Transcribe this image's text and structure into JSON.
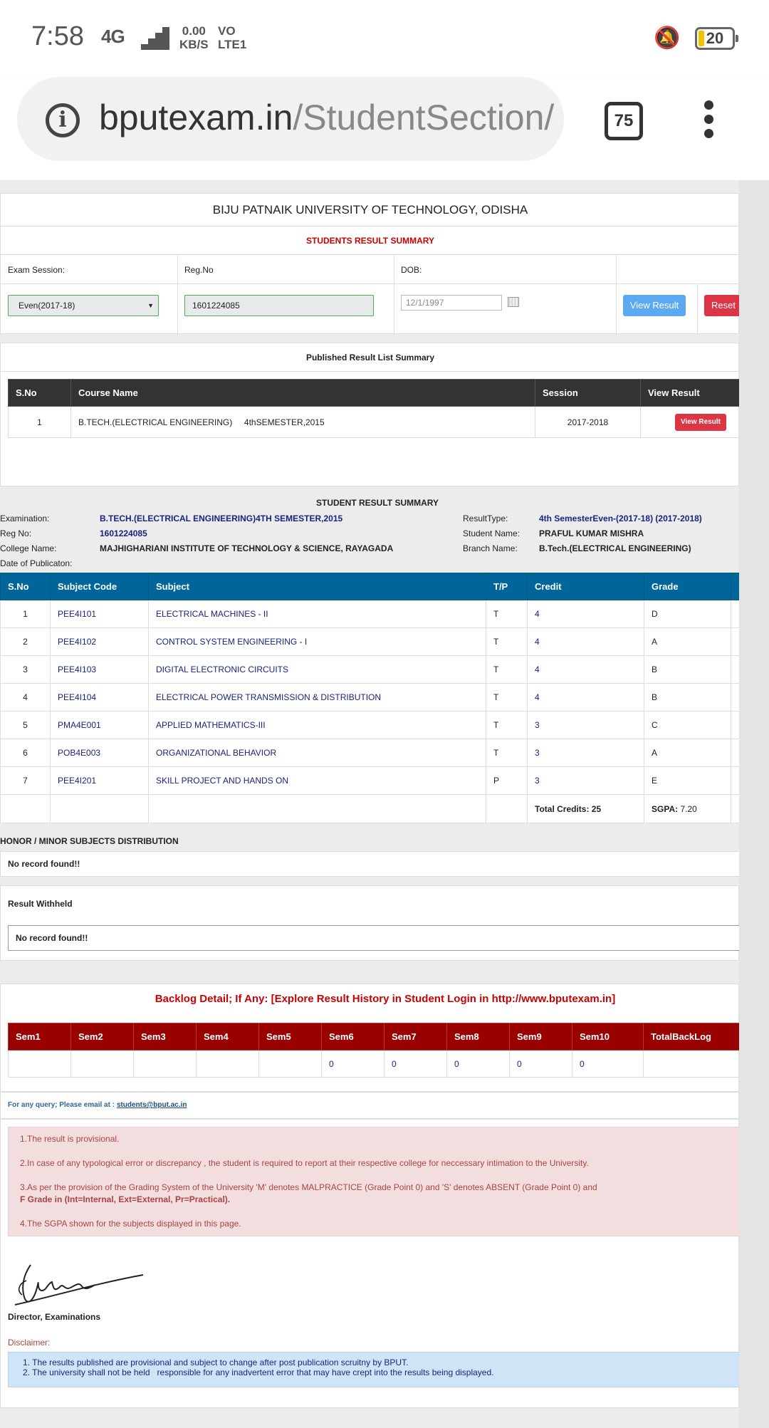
{
  "status": {
    "time": "7:58",
    "network": "4G",
    "speed_value": "0.00",
    "speed_unit": "KB/S",
    "volte": "VO",
    "lte": "LTE1",
    "battery": "20"
  },
  "browser": {
    "url_host": "bputexam.in",
    "url_path": "/StudentSection/",
    "tab_count": "75"
  },
  "header": {
    "university": "BIJU PATNAIK UNIVERSITY OF TECHNOLOGY, ODISHA",
    "summary_title": "STUDENTS RESULT SUMMARY"
  },
  "form": {
    "session_label": "Exam Session:",
    "reg_label": "Reg.No",
    "dob_label": "DOB:",
    "session_value": "Even(2017-18)",
    "reg_value": "1601224085",
    "dob_value": "12/1/1997",
    "view_btn": "View Result",
    "reset_btn": "Reset"
  },
  "published": {
    "title": "Published Result  List Summary",
    "headers": [
      "S.No",
      "Course Name",
      "Session",
      "View Result"
    ],
    "row": {
      "sno": "1",
      "course": "B.TECH.(ELECTRICAL ENGINEERING)     4thSEMESTER,2015",
      "session": "2017-2018",
      "btn": "View Result"
    }
  },
  "student": {
    "title": "STUDENT RESULT SUMMARY",
    "exam_label": "Examination:",
    "exam_value": "B.TECH.(ELECTRICAL ENGINEERING)4TH SEMESTER,2015",
    "reg_label": "Reg No:",
    "reg_value": "1601224085",
    "college_label": "College Name:",
    "college_value": "MAJHIGHARIANI INSTITUTE OF TECHNOLOGY & SCIENCE, RAYAGADA",
    "pub_label": "Date of Publicaton:",
    "rtype_label": "ResultType:",
    "rtype_value": "4th SemesterEven-(2017-18) (2017-2018)",
    "name_label": "Student Name:",
    "name_value": "PRAFUL KUMAR MISHRA",
    "branch_label": "Branch Name:",
    "branch_value": "B.Tech.(ELECTRICAL ENGINEERING)"
  },
  "grades": {
    "headers": [
      "S.No",
      "Subject Code",
      "Subject",
      "T/P",
      "Credit",
      "Grade"
    ],
    "rows": [
      {
        "sno": "1",
        "code": "PEE4I101",
        "subject": "ELECTRICAL MACHINES - II",
        "tp": "T",
        "credit": "4",
        "grade": "D"
      },
      {
        "sno": "2",
        "code": "PEE4I102",
        "subject": "CONTROL SYSTEM ENGINEERING - I",
        "tp": "T",
        "credit": "4",
        "grade": "A"
      },
      {
        "sno": "3",
        "code": "PEE4I103",
        "subject": "DIGITAL ELECTRONIC CIRCUITS",
        "tp": "T",
        "credit": "4",
        "grade": "B"
      },
      {
        "sno": "4",
        "code": "PEE4I104",
        "subject": "ELECTRICAL POWER TRANSMISSION & DISTRIBUTION",
        "tp": "T",
        "credit": "4",
        "grade": "B"
      },
      {
        "sno": "5",
        "code": "PMA4E001",
        "subject": "APPLIED MATHEMATICS-III",
        "tp": "T",
        "credit": "3",
        "grade": "C"
      },
      {
        "sno": "6",
        "code": "POB4E003",
        "subject": "ORGANIZATIONAL BEHAVIOR",
        "tp": "T",
        "credit": "3",
        "grade": "A"
      },
      {
        "sno": "7",
        "code": "PEE4I201",
        "subject": "SKILL PROJECT AND HANDS ON",
        "tp": "P",
        "credit": "3",
        "grade": "E"
      }
    ],
    "total_credits": "Total Credits: 25",
    "sgpa_label": "SGPA:",
    "sgpa_value": "7.20"
  },
  "honor": {
    "title": "HONOR / MINOR SUBJECTS DISTRIBUTION",
    "empty": "No record found!!"
  },
  "withheld": {
    "title": "Result Withheld",
    "empty": "No record found!!"
  },
  "backlog": {
    "title": "Backlog Detail; If Any: [Explore Result History in Student Login in http://www.bputexam.in]",
    "headers": [
      "Sem1",
      "Sem2",
      "Sem3",
      "Sem4",
      "Sem5",
      "Sem6",
      "Sem7",
      "Sem8",
      "Sem9",
      "Sem10",
      "TotalBackLog"
    ],
    "values": [
      "",
      "",
      "",
      "",
      "",
      "0",
      "0",
      "0",
      "0",
      "0",
      ""
    ]
  },
  "query": {
    "text": "For any query;  Please email at :",
    "email": "students@bput.ac.in"
  },
  "notes": [
    "1.The result is provisional.",
    "2.In case of any typological error or discrepancy , the student is required to report at their respective college for neccessary intimation to the University.",
    "3.As per the provision of the Grading System of the University 'M' denotes MALPRACTICE (Grade Point 0) and 'S' denotes ABSENT (Grade Point 0) and",
    "F Grade in (Int=Internal, Ext=External, Pr=Practical).",
    "4.The SGPA shown for the subjects displayed in this page."
  ],
  "signature": {
    "label": "Director, Examinations"
  },
  "disclaimer": {
    "label": "Disclaimer:",
    "lines": [
      "1. The results published are provisional and subject to change after post publication scruitny by BPUT.",
      "2. The university shall not be held   responsible for any inadvertent error that may have crept into the results being displayed."
    ]
  }
}
